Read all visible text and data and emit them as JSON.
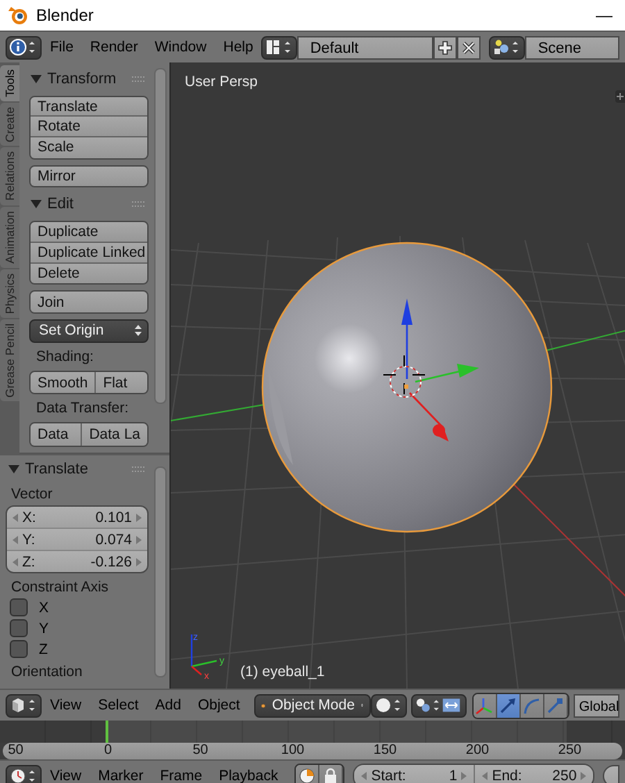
{
  "window": {
    "title": "Blender",
    "minimize": "—"
  },
  "info_header": {
    "menus": [
      "File",
      "Render",
      "Window",
      "Help"
    ],
    "layout": "Default",
    "scene": "Scene"
  },
  "tool_tabs": [
    {
      "label": "Tools",
      "selected": true
    },
    {
      "label": "Create",
      "selected": false
    },
    {
      "label": "Relations",
      "selected": false
    },
    {
      "label": "Animation",
      "selected": false
    },
    {
      "label": "Physics",
      "selected": false
    },
    {
      "label": "Grease Pencil",
      "selected": false
    }
  ],
  "tool_shelf": [
    {
      "kind": "panel_header",
      "label": "Transform",
      "expanded": true
    },
    {
      "kind": "button_column",
      "buttons": [
        "Translate",
        "Rotate",
        "Scale"
      ]
    },
    {
      "kind": "button_column",
      "buttons": [
        "Mirror"
      ]
    },
    {
      "kind": "panel_header",
      "label": "Edit",
      "expanded": true
    },
    {
      "kind": "button_column",
      "buttons": [
        "Duplicate",
        "Duplicate Linked",
        "Delete"
      ]
    },
    {
      "kind": "button_column",
      "buttons": [
        "Join"
      ]
    },
    {
      "kind": "dropdown",
      "label": "Set Origin"
    },
    {
      "kind": "label",
      "label": "Shading:"
    },
    {
      "kind": "button_row",
      "buttons": [
        "Smooth",
        "Flat"
      ]
    },
    {
      "kind": "label",
      "label": "Data Transfer:"
    },
    {
      "kind": "button_row",
      "buttons": [
        "Data",
        "Data La"
      ]
    }
  ],
  "operator_panel": {
    "title": "Translate",
    "expanded": true,
    "vector_label": "Vector",
    "vector": [
      {
        "axis": "X:",
        "value": "0.101"
      },
      {
        "axis": "Y:",
        "value": "0.074"
      },
      {
        "axis": "Z:",
        "value": "-0.126"
      }
    ],
    "constraint_label": "Constraint Axis",
    "constraints": [
      {
        "label": "X",
        "checked": false
      },
      {
        "label": "Y",
        "checked": false
      },
      {
        "label": "Z",
        "checked": false
      }
    ],
    "next_label": "Orientation"
  },
  "viewport": {
    "view_name": "User Persp",
    "object_label": "(1) eyeball_1",
    "axis_labels": [
      "z",
      "y",
      "x"
    ]
  },
  "viewport_header": {
    "menus": [
      "View",
      "Select",
      "Add",
      "Object"
    ],
    "mode": "Object Mode",
    "manipulators": [
      {
        "kind": "axes",
        "selected": false
      },
      {
        "kind": "translate",
        "selected": true
      },
      {
        "kind": "rotate",
        "selected": false
      },
      {
        "kind": "scale",
        "selected": false
      }
    ],
    "orientation": "Global"
  },
  "timeline": {
    "ruler": [
      "50",
      "0",
      "50",
      "100",
      "150",
      "200",
      "250"
    ]
  },
  "timeline_header": {
    "menus": [
      "View",
      "Marker",
      "Frame",
      "Playback"
    ],
    "start_label": "Start:",
    "start": "1",
    "end_label": "End:",
    "end": "250"
  }
}
